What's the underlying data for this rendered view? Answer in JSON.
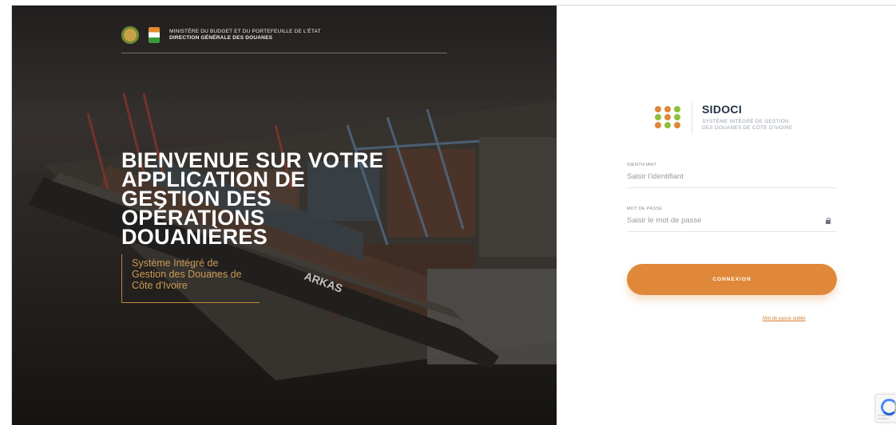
{
  "hero": {
    "ministry_line1": "MINISTÈRE DU BUDGET ET DU PORTEFEUILLE DE L'ÉTAT",
    "ministry_line2": "DIRECTION GÉNÉRALE DES DOUANES",
    "title_lines": [
      "BIENVENUE SUR VOTRE",
      "APPLICATION DE",
      "GESTION DES",
      "OPÉRATIONS",
      "DOUANIÈRES"
    ],
    "subtitle_lines": [
      "Système Intégré de",
      "Gestion des Douanes de",
      "Côte d'Ivoire"
    ],
    "ship_label": "ARKAS"
  },
  "brand": {
    "name": "SIDOCI",
    "tag_line1": "SYSTÈME INTÉGRÉ DE GESTION",
    "tag_line2": "DES DOUANES DE CÔTE D'IVOIRE",
    "dot_colors": [
      "#e0883a",
      "#e0883a",
      "#8fbf3a",
      "#8fbf3a",
      "#e0883a",
      "#8fbf3a",
      "#e0883a",
      "#8fbf3a",
      "#e0883a"
    ]
  },
  "login": {
    "id_label": "IDENTIFIANT",
    "id_placeholder": "Saisir l'identifiant",
    "password_label": "MOT DE PASSE",
    "password_placeholder": "Saisir le mot de passe",
    "password_icon": "lock-icon",
    "submit_label": "CONNEXION",
    "forgot_label": "Mot de passe oublié"
  },
  "recaptcha": {
    "icon": "recaptcha-icon",
    "text": "Confidentialité - Conditions"
  },
  "colors": {
    "accent": "#e0883a",
    "brand_navy": "#243144",
    "hero_sub": "#c99a56"
  }
}
